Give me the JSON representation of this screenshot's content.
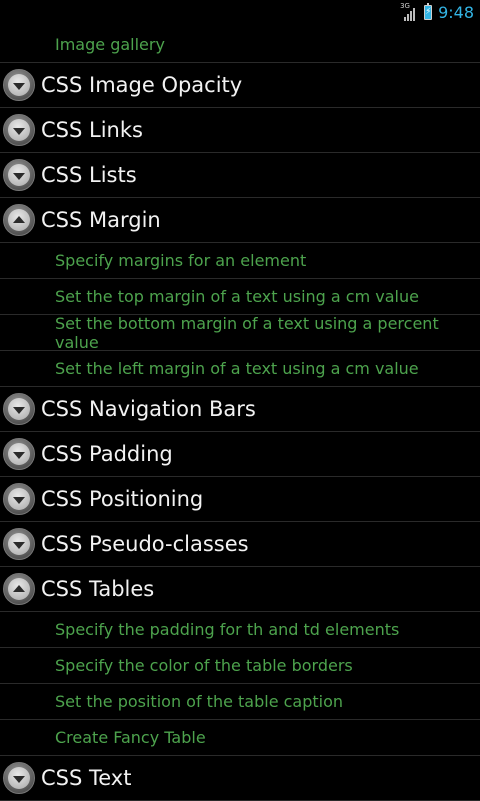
{
  "status_bar": {
    "network_type": "3G",
    "time": "9:48"
  },
  "list": [
    {
      "type": "child",
      "label": "Image gallery"
    },
    {
      "type": "group",
      "label": "CSS Image Opacity",
      "expanded": false
    },
    {
      "type": "group",
      "label": "CSS Links",
      "expanded": false
    },
    {
      "type": "group",
      "label": "CSS Lists",
      "expanded": false
    },
    {
      "type": "group",
      "label": "CSS Margin",
      "expanded": true
    },
    {
      "type": "child",
      "label": "Specify margins for an element"
    },
    {
      "type": "child",
      "label": "Set the top margin of a text using a cm value"
    },
    {
      "type": "child",
      "label": "Set the bottom margin of a text using a percent value"
    },
    {
      "type": "child",
      "label": "Set the left margin of a text using a cm value"
    },
    {
      "type": "group",
      "label": "CSS Navigation Bars",
      "expanded": false
    },
    {
      "type": "group",
      "label": "CSS Padding",
      "expanded": false
    },
    {
      "type": "group",
      "label": "CSS Positioning",
      "expanded": false
    },
    {
      "type": "group",
      "label": "CSS Pseudo-classes",
      "expanded": false
    },
    {
      "type": "group",
      "label": "CSS Tables",
      "expanded": true
    },
    {
      "type": "child",
      "label": "Specify the padding for th and td elements"
    },
    {
      "type": "child",
      "label": "Specify the color of the table borders"
    },
    {
      "type": "child",
      "label": "Set the position of the table caption"
    },
    {
      "type": "child",
      "label": "Create Fancy Table"
    },
    {
      "type": "group",
      "label": "CSS Text",
      "expanded": false
    }
  ]
}
